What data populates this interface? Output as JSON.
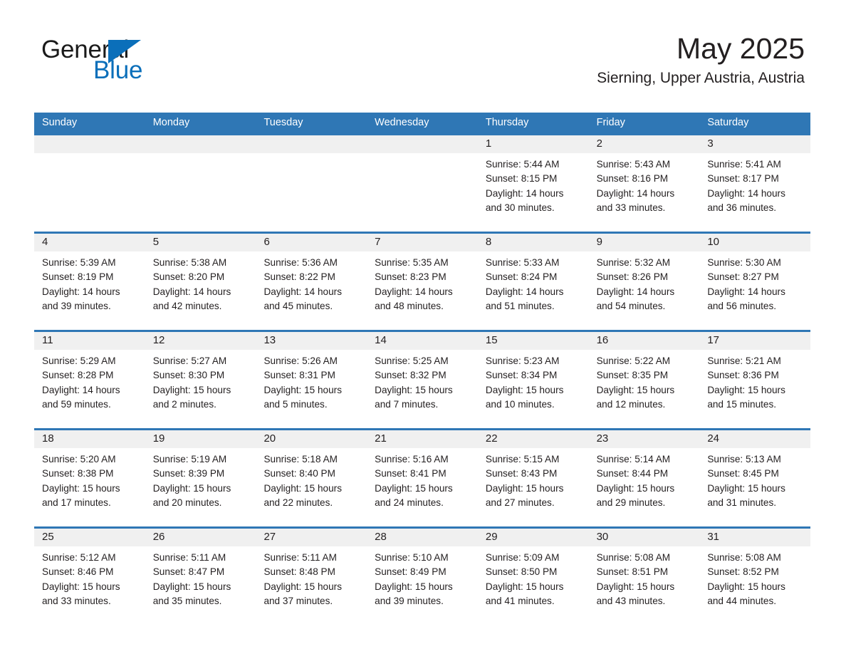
{
  "brand": {
    "name_part1": "General",
    "name_part2": "Blue",
    "triangle_color": "#0b6fba",
    "text_color_part1": "#1a1a1a",
    "text_color_part2": "#0b6fba"
  },
  "header": {
    "title": "May 2025",
    "location": "Sierning, Upper Austria, Austria",
    "accent_color": "#2f77b5",
    "datestrip_color": "#f0f0f0"
  },
  "weekdays": [
    "Sunday",
    "Monday",
    "Tuesday",
    "Wednesday",
    "Thursday",
    "Friday",
    "Saturday"
  ],
  "weeks": [
    [
      {
        "day": "",
        "info": ""
      },
      {
        "day": "",
        "info": ""
      },
      {
        "day": "",
        "info": ""
      },
      {
        "day": "",
        "info": ""
      },
      {
        "day": "1",
        "info": "Sunrise: 5:44 AM\nSunset: 8:15 PM\nDaylight: 14 hours\nand 30 minutes."
      },
      {
        "day": "2",
        "info": "Sunrise: 5:43 AM\nSunset: 8:16 PM\nDaylight: 14 hours\nand 33 minutes."
      },
      {
        "day": "3",
        "info": "Sunrise: 5:41 AM\nSunset: 8:17 PM\nDaylight: 14 hours\nand 36 minutes."
      }
    ],
    [
      {
        "day": "4",
        "info": "Sunrise: 5:39 AM\nSunset: 8:19 PM\nDaylight: 14 hours\nand 39 minutes."
      },
      {
        "day": "5",
        "info": "Sunrise: 5:38 AM\nSunset: 8:20 PM\nDaylight: 14 hours\nand 42 minutes."
      },
      {
        "day": "6",
        "info": "Sunrise: 5:36 AM\nSunset: 8:22 PM\nDaylight: 14 hours\nand 45 minutes."
      },
      {
        "day": "7",
        "info": "Sunrise: 5:35 AM\nSunset: 8:23 PM\nDaylight: 14 hours\nand 48 minutes."
      },
      {
        "day": "8",
        "info": "Sunrise: 5:33 AM\nSunset: 8:24 PM\nDaylight: 14 hours\nand 51 minutes."
      },
      {
        "day": "9",
        "info": "Sunrise: 5:32 AM\nSunset: 8:26 PM\nDaylight: 14 hours\nand 54 minutes."
      },
      {
        "day": "10",
        "info": "Sunrise: 5:30 AM\nSunset: 8:27 PM\nDaylight: 14 hours\nand 56 minutes."
      }
    ],
    [
      {
        "day": "11",
        "info": "Sunrise: 5:29 AM\nSunset: 8:28 PM\nDaylight: 14 hours\nand 59 minutes."
      },
      {
        "day": "12",
        "info": "Sunrise: 5:27 AM\nSunset: 8:30 PM\nDaylight: 15 hours\nand 2 minutes."
      },
      {
        "day": "13",
        "info": "Sunrise: 5:26 AM\nSunset: 8:31 PM\nDaylight: 15 hours\nand 5 minutes."
      },
      {
        "day": "14",
        "info": "Sunrise: 5:25 AM\nSunset: 8:32 PM\nDaylight: 15 hours\nand 7 minutes."
      },
      {
        "day": "15",
        "info": "Sunrise: 5:23 AM\nSunset: 8:34 PM\nDaylight: 15 hours\nand 10 minutes."
      },
      {
        "day": "16",
        "info": "Sunrise: 5:22 AM\nSunset: 8:35 PM\nDaylight: 15 hours\nand 12 minutes."
      },
      {
        "day": "17",
        "info": "Sunrise: 5:21 AM\nSunset: 8:36 PM\nDaylight: 15 hours\nand 15 minutes."
      }
    ],
    [
      {
        "day": "18",
        "info": "Sunrise: 5:20 AM\nSunset: 8:38 PM\nDaylight: 15 hours\nand 17 minutes."
      },
      {
        "day": "19",
        "info": "Sunrise: 5:19 AM\nSunset: 8:39 PM\nDaylight: 15 hours\nand 20 minutes."
      },
      {
        "day": "20",
        "info": "Sunrise: 5:18 AM\nSunset: 8:40 PM\nDaylight: 15 hours\nand 22 minutes."
      },
      {
        "day": "21",
        "info": "Sunrise: 5:16 AM\nSunset: 8:41 PM\nDaylight: 15 hours\nand 24 minutes."
      },
      {
        "day": "22",
        "info": "Sunrise: 5:15 AM\nSunset: 8:43 PM\nDaylight: 15 hours\nand 27 minutes."
      },
      {
        "day": "23",
        "info": "Sunrise: 5:14 AM\nSunset: 8:44 PM\nDaylight: 15 hours\nand 29 minutes."
      },
      {
        "day": "24",
        "info": "Sunrise: 5:13 AM\nSunset: 8:45 PM\nDaylight: 15 hours\nand 31 minutes."
      }
    ],
    [
      {
        "day": "25",
        "info": "Sunrise: 5:12 AM\nSunset: 8:46 PM\nDaylight: 15 hours\nand 33 minutes."
      },
      {
        "day": "26",
        "info": "Sunrise: 5:11 AM\nSunset: 8:47 PM\nDaylight: 15 hours\nand 35 minutes."
      },
      {
        "day": "27",
        "info": "Sunrise: 5:11 AM\nSunset: 8:48 PM\nDaylight: 15 hours\nand 37 minutes."
      },
      {
        "day": "28",
        "info": "Sunrise: 5:10 AM\nSunset: 8:49 PM\nDaylight: 15 hours\nand 39 minutes."
      },
      {
        "day": "29",
        "info": "Sunrise: 5:09 AM\nSunset: 8:50 PM\nDaylight: 15 hours\nand 41 minutes."
      },
      {
        "day": "30",
        "info": "Sunrise: 5:08 AM\nSunset: 8:51 PM\nDaylight: 15 hours\nand 43 minutes."
      },
      {
        "day": "31",
        "info": "Sunrise: 5:08 AM\nSunset: 8:52 PM\nDaylight: 15 hours\nand 44 minutes."
      }
    ]
  ]
}
